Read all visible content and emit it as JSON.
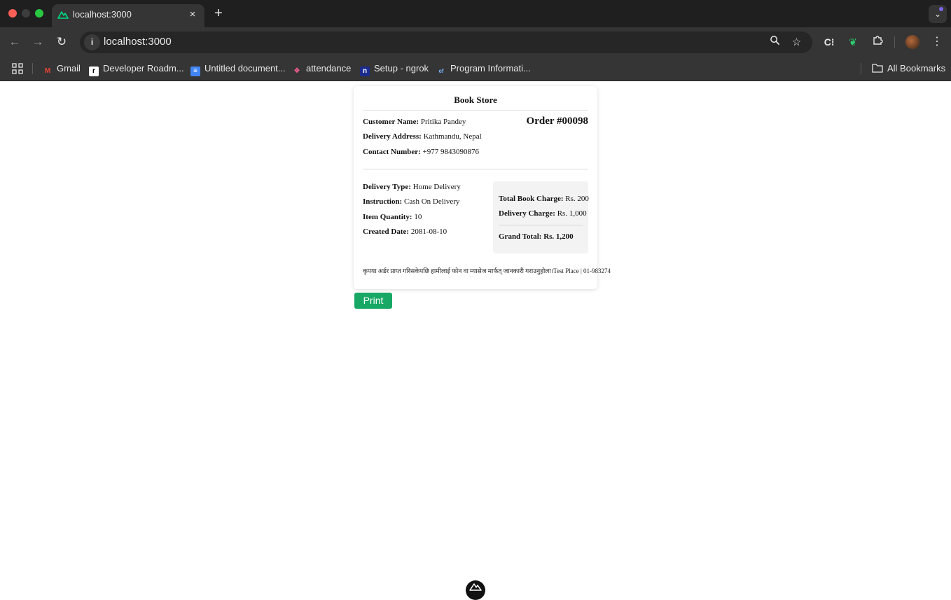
{
  "browser": {
    "tab": {
      "title": "localhost:3000",
      "close": "×"
    },
    "new_tab": "+",
    "address": "localhost:3000",
    "bookmarks": [
      {
        "label": "Gmail"
      },
      {
        "label": "Developer Roadm..."
      },
      {
        "label": "Untitled document..."
      },
      {
        "label": "attendance"
      },
      {
        "label": "Setup - ngrok"
      },
      {
        "label": "Program Informati..."
      }
    ],
    "all_bookmarks": "All Bookmarks"
  },
  "receipt": {
    "store": "Book Store",
    "order_number": "Order #00098",
    "customer": {
      "name_label": "Customer Name:",
      "name": "Pritika Pandey",
      "address_label": "Delivery Address:",
      "address": "Kathmandu, Nepal",
      "contact_label": "Contact Number:",
      "contact": "+977 9843090876"
    },
    "details": {
      "delivery_type_label": "Delivery Type:",
      "delivery_type": "Home Delivery",
      "instruction_label": "Instruction:",
      "instruction": "Cash On Delivery",
      "quantity_label": "Item Quantity:",
      "quantity": "10",
      "created_label": "Created Date:",
      "created": "2081-08-10"
    },
    "summary": {
      "book_charge_label": "Total Book Charge:",
      "book_charge": "Rs. 200",
      "delivery_charge_label": "Delivery Charge:",
      "delivery_charge": "Rs. 1,000",
      "grand_total_label": "Grand Total:",
      "grand_total": "Rs. 1,200"
    },
    "footer_note": "कृपया अर्डर प्राप्त गरिसकेपछि हामीलाई फोन वा म्यासेज मार्फत् जानकारी गराउनुहोला।Test Place | 01-983274"
  },
  "actions": {
    "print_label": "Print"
  },
  "colors": {
    "print_button": "#17a865",
    "tab_bar": "#1f1f1f",
    "toolbar": "#353535"
  }
}
